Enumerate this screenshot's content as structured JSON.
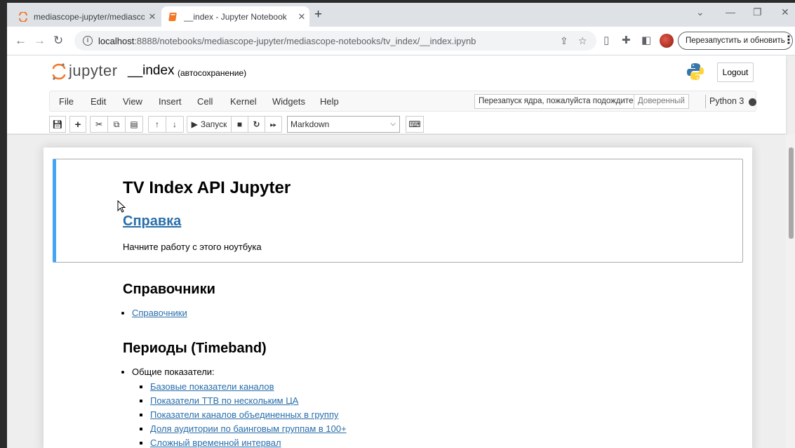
{
  "browser": {
    "tabs": [
      {
        "title": "mediascope-jupyter/mediascope-n",
        "active": false
      },
      {
        "title": "__index - Jupyter Notebook",
        "active": true
      }
    ],
    "new_tab": "+",
    "window_controls": {
      "dropdown": "⌄",
      "minimize": "—",
      "restore": "❐",
      "close": "✕"
    },
    "tab_close": "✕",
    "address": {
      "host": "localhost",
      "rest": ":8888/notebooks/mediascope-jupyter/mediascope-notebooks/tv_index/__index.ipynb"
    },
    "restart_button": "Перезапустить и обновить",
    "menu": "⋮"
  },
  "jupyter": {
    "logo_text": "jupyter",
    "notebook_name": "__index",
    "autosave": "(автосохранение)",
    "logout": "Logout",
    "menu": [
      "File",
      "Edit",
      "View",
      "Insert",
      "Cell",
      "Kernel",
      "Widgets",
      "Help"
    ],
    "kernel_message": "Перезапуск ядра, пожалуйста подождите...",
    "trusted": "Доверенный",
    "kernel_name": "Python 3",
    "toolbar": {
      "run_label": "Запуск",
      "cell_type": "Markdown"
    }
  },
  "notebook": {
    "title": "TV Index API Jupyter",
    "help_link": "Справка",
    "intro": "Начните работу с этого ноутбука",
    "section1": {
      "heading": "Справочники",
      "items": [
        "Справочники"
      ]
    },
    "section2": {
      "heading": "Периоды (Timeband)",
      "group": "Общие показатели:",
      "items": [
        "Базовые показатели каналов",
        "Показатели ТТВ по нескольким ЦА",
        "Показатели каналов объединенных в группу",
        "Доля аудитории по баинговым группам в 100+",
        "Сложный временной интервал"
      ]
    }
  },
  "colors": {
    "link": "#296eaa",
    "selected_cell_border": "#42a5f5",
    "jupyter_orange": "#f37726"
  }
}
